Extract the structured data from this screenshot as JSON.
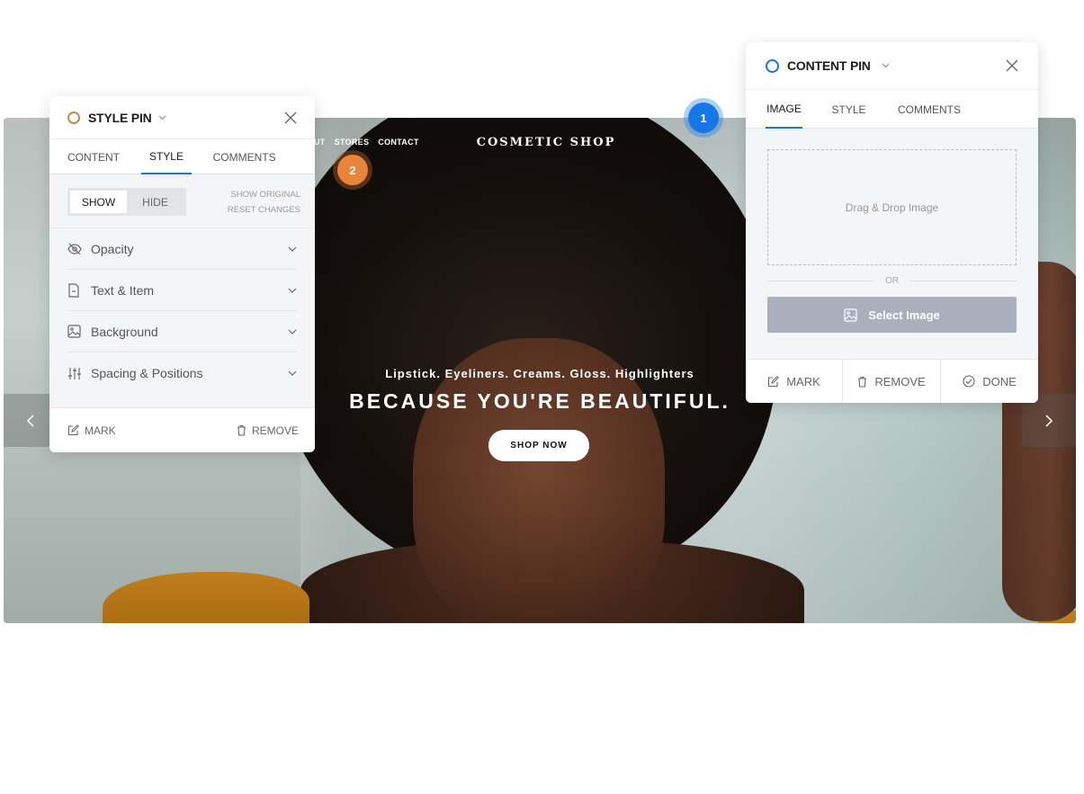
{
  "hero": {
    "nav_items": [
      "UT",
      "STORES",
      "CONTACT"
    ],
    "logo": "COSMETIC SHOP",
    "subtitle": "Lipstick. Eyeliners. Creams. Gloss. Highlighters",
    "title": "BECAUSE YOU'RE BEAUTIFUL.",
    "cta_label": "SHOP NOW",
    "prev_icon": "chevron-left-icon",
    "next_icon": "chevron-right-icon"
  },
  "pins": {
    "content_pin_number": "1",
    "style_pin_number": "2"
  },
  "style_pin": {
    "title": "STYLE PIN",
    "ring_color": "#c58a45",
    "tabs": [
      "CONTENT",
      "STYLE",
      "COMMENTS"
    ],
    "active_tab": "STYLE",
    "toggle": {
      "show": "SHOW",
      "hide": "HIDE",
      "selected": "SHOW"
    },
    "links": {
      "show_original": "SHOW ORIGINAL",
      "reset_changes": "RESET CHANGES"
    },
    "sections": [
      {
        "label": "Opacity",
        "icon": "eye-off-icon"
      },
      {
        "label": "Text & Item",
        "icon": "document-icon"
      },
      {
        "label": "Background",
        "icon": "image-icon"
      },
      {
        "label": "Spacing & Positions",
        "icon": "sliders-icon"
      }
    ],
    "footer": {
      "mark": "MARK",
      "remove": "REMOVE"
    }
  },
  "content_pin": {
    "title": "CONTENT PIN",
    "ring_color": "#1677e6",
    "tabs": [
      "IMAGE",
      "STYLE",
      "COMMENTS"
    ],
    "active_tab": "IMAGE",
    "dropzone_text": "Drag & Drop Image",
    "or_text": "OR",
    "select_button": "Select Image",
    "footer": {
      "mark": "MARK",
      "remove": "REMOVE",
      "done": "DONE"
    }
  },
  "colors": {
    "accent": "#1677e6",
    "pin_orange": "#e8843b",
    "select_button_bg": "#a9b0bb"
  }
}
